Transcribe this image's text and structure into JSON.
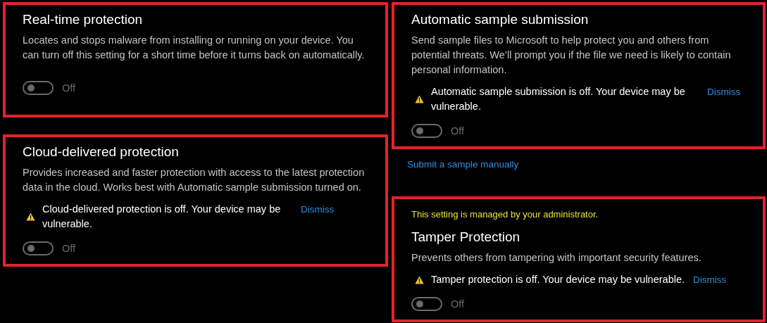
{
  "columns": [
    {
      "items": [
        {
          "kind": "panel",
          "title": "Real-time protection",
          "description": "Locates and stops malware from installing or running on your device. You can turn off this setting for a short time before it turns back on automatically.",
          "toggle": {
            "on": false,
            "label": "Off"
          }
        },
        {
          "kind": "panel",
          "title": "Cloud-delivered protection",
          "description": "Provides increased and faster protection with access to the latest protection data in the cloud. Works best with Automatic sample submission turned on.",
          "warning": {
            "text": "Cloud-delivered protection is off. Your device may be vulnerable.",
            "action": "Dismiss"
          },
          "toggle": {
            "on": false,
            "label": "Off"
          }
        }
      ]
    },
    {
      "items": [
        {
          "kind": "panel",
          "title": "Automatic sample submission",
          "description": "Send sample files to Microsoft to help protect you and others from potential threats. We’ll prompt you if the file we need is likely to contain personal information.",
          "warning": {
            "text": "Automatic sample submission is off. Your device may be vulnerable.",
            "action": "Dismiss"
          },
          "toggle": {
            "on": false,
            "label": "Off"
          }
        },
        {
          "kind": "link",
          "text": "Submit a sample manually"
        },
        {
          "kind": "panel",
          "note": "This setting is managed by your administrator.",
          "title": "Tamper Protection",
          "description": "Prevents others from tampering with important security features.",
          "warning": {
            "text": "Tamper protection is off. Your device may be vulnerable.",
            "action": "Dismiss"
          },
          "toggle": {
            "on": false,
            "label": "Off"
          }
        }
      ]
    }
  ]
}
